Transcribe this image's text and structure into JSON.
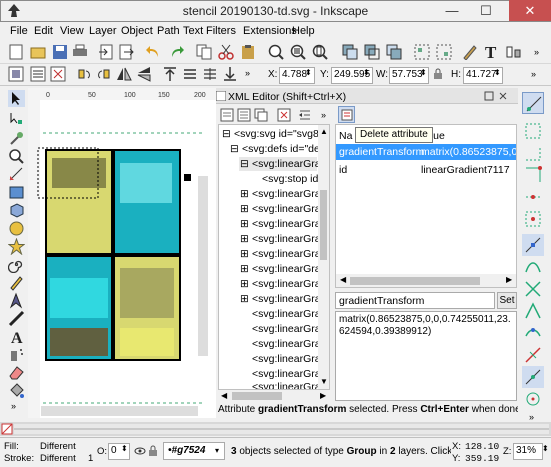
{
  "window": {
    "title": "stencil 20190130-td.svg - Inkscape",
    "minimize": "—",
    "maximize": "☐",
    "close": "✕"
  },
  "menu": [
    "File",
    "Edit",
    "View",
    "Layer",
    "Object",
    "Path",
    "Text",
    "Filters",
    "Extensions",
    "Help"
  ],
  "toolbar2": {
    "x_label": "X:",
    "x_value": "4.788",
    "y_label": "Y:",
    "y_value": "249.595",
    "w_label": "W:",
    "w_value": "57.753",
    "h_label": "H:",
    "h_value": "41.727"
  },
  "xml_editor": {
    "title": "XML Editor (Shift+Ctrl+X)",
    "tooltip": "Delete attribute",
    "tree": [
      "<svg:svg id=\"svg8\">",
      "<svg:defs id=\"defs",
      "<svg:linearGradi",
      "<svg:stop id=",
      "<svg:linearGradi",
      "<svg:linearGradi",
      "<svg:linearGradi",
      "<svg:linearGradi",
      "<svg:linearGradi",
      "<svg:linearGradi",
      "<svg:linearGradi",
      "<svg:linearGradi",
      "<svg:linearGradi",
      "<svg:linearGradi",
      "<svg:linearGradi",
      "<svg:linearGradi",
      "<svg:linearGradi",
      "<svg:linearGradi"
    ],
    "attr_header_name": "Na",
    "attr_header_value": "alue",
    "attrs": [
      {
        "name": "gradientTransform",
        "value": "matrix(0.86523875,0,0,"
      },
      {
        "name": "id",
        "value": "linearGradient7117"
      }
    ],
    "edit_name": "gradientTransform",
    "set_label": "Set",
    "edit_value": "matrix(0.86523875,0,0,0.74255011,23.624594,0.39389912)",
    "hint_pre": "Attribute ",
    "hint_attr": "gradientTransform",
    "hint_mid": " selected. Press ",
    "hint_key": "Ctrl+Enter",
    "hint_post": " when done editi"
  },
  "status": {
    "fill_label": "Fill:",
    "fill_value": "Different",
    "stroke_label": "Stroke:",
    "stroke_value": "Different",
    "stroke_width": "1",
    "opacity_label": "O:",
    "opacity_value": "0",
    "layer": "•#g7524",
    "message_pre": "3",
    "message": " objects selected of type ",
    "msg_group": "Group",
    "msg_in": " in ",
    "msg_layers": "2",
    "msg_end": " layers. Click sele...",
    "x_label": "X:",
    "x_value": "128.10",
    "y_label": "Y:",
    "y_value": "359.19",
    "zoom_label": "Z:",
    "zoom_value": "31%"
  },
  "ruler": {
    "ticks": [
      "0",
      "50",
      "100",
      "150",
      "200"
    ]
  }
}
